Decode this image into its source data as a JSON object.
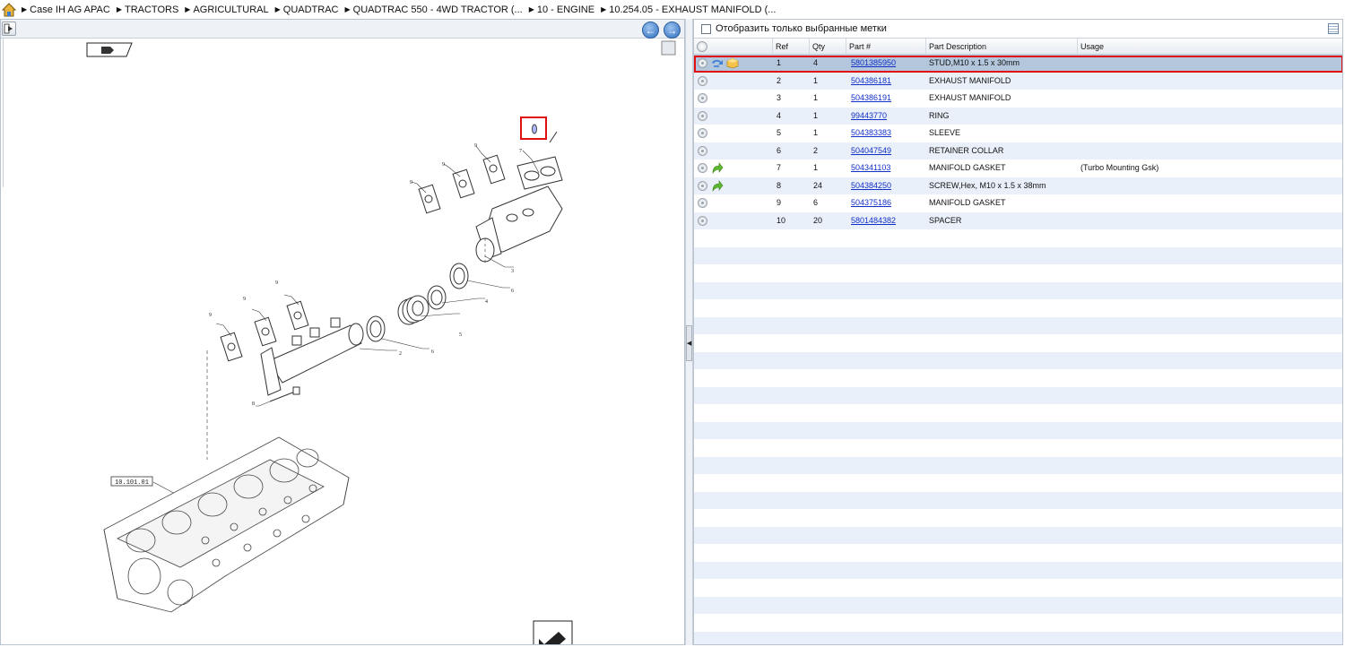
{
  "breadcrumb": [
    {
      "label": "Case IH AG APAC"
    },
    {
      "label": "TRACTORS"
    },
    {
      "label": "AGRICULTURAL"
    },
    {
      "label": "QUADTRAC"
    },
    {
      "label": "QUADTRAC 550 - 4WD TRACTOR (..."
    },
    {
      "label": "10 - ENGINE"
    },
    {
      "label": "10.254.05 - EXHAUST MANIFOLD (..."
    }
  ],
  "nav": {
    "back_glyph": "←",
    "forward_glyph": "→"
  },
  "filter": {
    "label": "Отобразить только выбранные метки",
    "checked": false
  },
  "columns": {
    "ref": "Ref",
    "qty": "Qty",
    "part": "Part #",
    "desc": "Part Description",
    "usage": "Usage"
  },
  "parts": [
    {
      "ref": "1",
      "qty": "4",
      "part": "5801385950",
      "desc": "STUD,M10 x 1.5 x 30mm",
      "usage": "",
      "icon": "swap-box",
      "selected": true
    },
    {
      "ref": "2",
      "qty": "1",
      "part": "504386181",
      "desc": "EXHAUST MANIFOLD",
      "usage": "",
      "icon": ""
    },
    {
      "ref": "3",
      "qty": "1",
      "part": "504386191",
      "desc": "EXHAUST MANIFOLD",
      "usage": "",
      "icon": ""
    },
    {
      "ref": "4",
      "qty": "1",
      "part": "99443770",
      "desc": "RING",
      "usage": "",
      "icon": ""
    },
    {
      "ref": "5",
      "qty": "1",
      "part": "504383383",
      "desc": "SLEEVE",
      "usage": "",
      "icon": ""
    },
    {
      "ref": "6",
      "qty": "2",
      "part": "504047549",
      "desc": "RETAINER COLLAR",
      "usage": "",
      "icon": ""
    },
    {
      "ref": "7",
      "qty": "1",
      "part": "504341103",
      "desc": "MANIFOLD GASKET",
      "usage": "(Turbo Mounting Gsk)",
      "icon": "green-arrow"
    },
    {
      "ref": "8",
      "qty": "24",
      "part": "504384250",
      "desc": "SCREW,Hex, M10 x 1.5 x 38mm",
      "usage": "",
      "icon": "green-arrow"
    },
    {
      "ref": "9",
      "qty": "6",
      "part": "504375186",
      "desc": "MANIFOLD GASKET",
      "usage": "",
      "icon": ""
    },
    {
      "ref": "10",
      "qty": "20",
      "part": "5801484382",
      "desc": "SPACER",
      "usage": "",
      "icon": ""
    }
  ],
  "drawing": {
    "callouts": [
      "1",
      "2",
      "3",
      "4",
      "5",
      "6",
      "6",
      "7",
      "8",
      "9",
      "9",
      "9",
      "9",
      "9",
      "9"
    ],
    "ref_box": "10.101.01"
  },
  "colors": {
    "selected_row": "#b3c6dc",
    "alt_row": "#eaf0f9",
    "link": "#1030c8",
    "highlight": "#e01010"
  }
}
